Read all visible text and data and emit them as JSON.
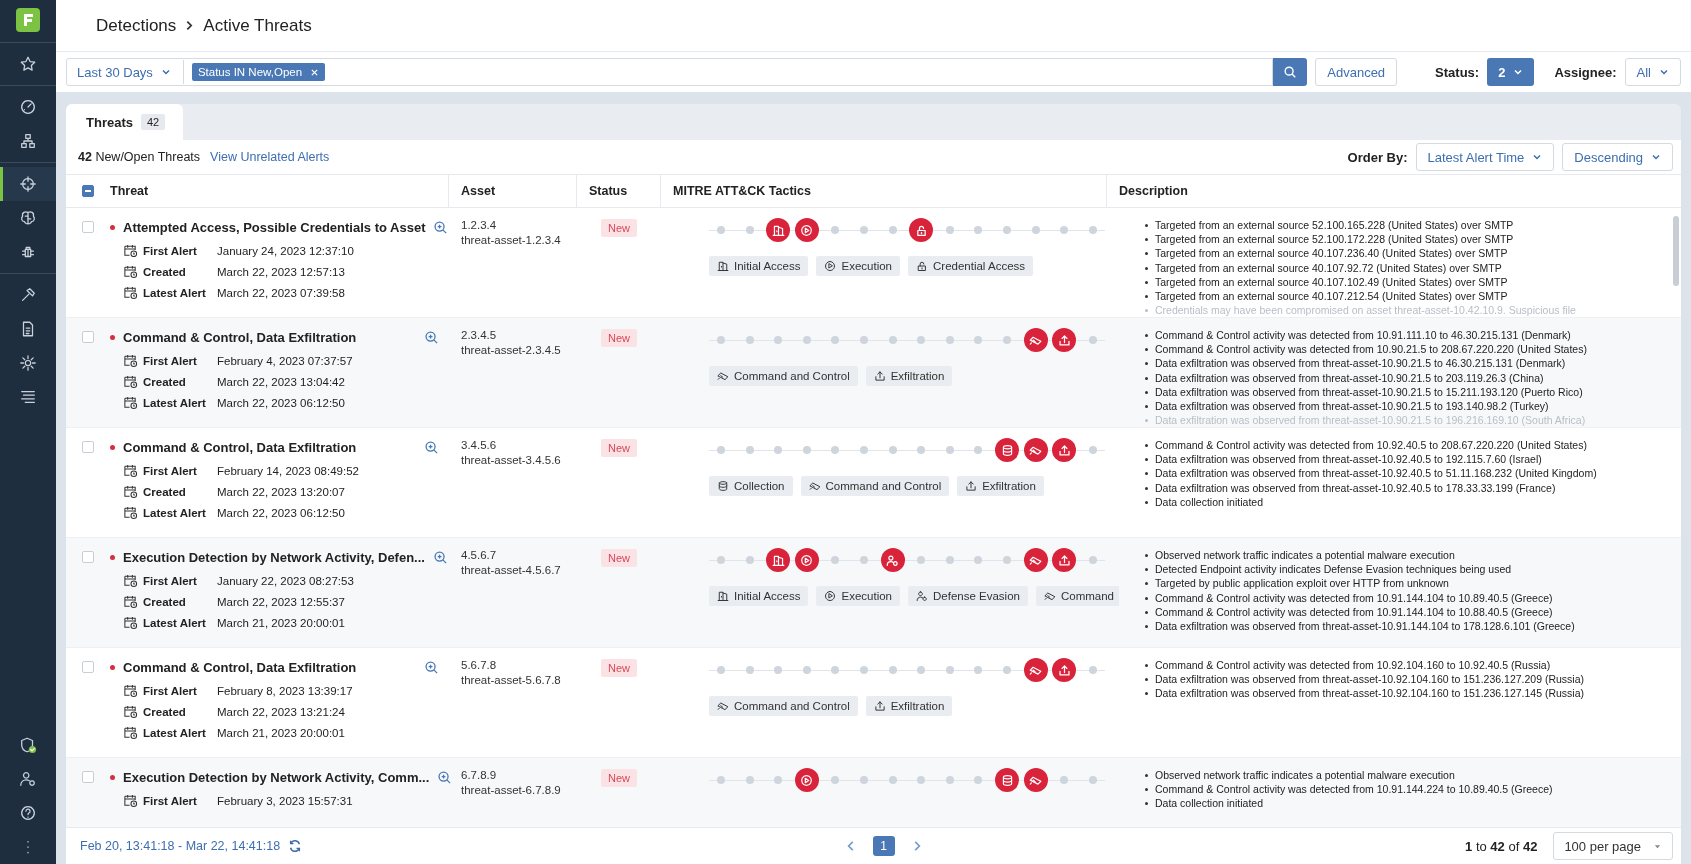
{
  "sidebar": {
    "groups": [
      {
        "items": [
          {
            "kind": "star",
            "selected": false
          }
        ]
      },
      {
        "items": [
          {
            "kind": "gauge",
            "selected": false
          },
          {
            "kind": "network",
            "selected": false
          }
        ]
      },
      {
        "items": [
          {
            "kind": "crosshair",
            "selected": true
          },
          {
            "kind": "brain",
            "selected": false
          },
          {
            "kind": "bug",
            "selected": false
          }
        ]
      },
      {
        "items": [
          {
            "kind": "hammer",
            "selected": false
          },
          {
            "kind": "document",
            "selected": false
          },
          {
            "kind": "gear",
            "selected": false
          },
          {
            "kind": "list",
            "selected": false
          }
        ]
      }
    ],
    "bottom_items": [
      {
        "kind": "shield-check",
        "selected": false
      },
      {
        "kind": "user-gear",
        "selected": false
      },
      {
        "kind": "help",
        "selected": false
      },
      {
        "kind": "more",
        "selected": false
      }
    ]
  },
  "breadcrumb": [
    "Detections",
    "Active Threats"
  ],
  "filter": {
    "date_range": "Last 30 Days",
    "chip": "Status IN New,Open",
    "advanced": "Advanced",
    "status_label": "Status:",
    "status_value": "2",
    "assignee_label": "Assignee:",
    "assignee_value": "All"
  },
  "tabs": [
    {
      "label": "Threats",
      "count": "42",
      "selected": true
    }
  ],
  "summary": "**42** New/Open Threats",
  "unrelated_link": "View Unrelated Alerts",
  "order_by": {
    "label": "Order By:",
    "field": "Latest Alert Time",
    "direction": "Descending"
  },
  "table": {
    "select_all": {
      "indeterminate": true
    },
    "columns": [
      "Threat",
      "Asset",
      "Status",
      "MITRE ATT&CK Tactics",
      "Description"
    ],
    "rows": [
      {
        "checked": false,
        "title": "Attempted Access, Possible Credentials to Asset",
        "dates": [
          {
            "label": "First Alert",
            "value": "January 24, 2023 12:37:10"
          },
          {
            "label": "Created",
            "value": "March 22, 2023 12:57:13"
          },
          {
            "label": "Latest Alert",
            "value": "March 22, 2023 07:39:58"
          }
        ],
        "asset_ip": "1.2.3.4",
        "asset_name": "threat-asset-1.2.3.4",
        "status": "New",
        "timeline": [
          {
            "active": false
          },
          {
            "active": false
          },
          {
            "active": true,
            "kind": "initial-access"
          },
          {
            "active": true,
            "kind": "execution"
          },
          {
            "active": false
          },
          {
            "active": false
          },
          {
            "active": false
          },
          {
            "active": true,
            "kind": "credential-access"
          },
          {
            "active": false
          },
          {
            "active": false
          },
          {
            "active": false
          },
          {
            "active": false
          },
          {
            "active": false
          },
          {
            "active": false
          }
        ],
        "tags": [
          {
            "label": "Initial Access",
            "kind": "initial-access"
          },
          {
            "label": "Execution",
            "kind": "execution"
          },
          {
            "label": "Credential Access",
            "kind": "credential-access"
          }
        ],
        "truncated": true,
        "description": [
          "Targeted from an external source 52.100.165.228 (United States) over SMTP",
          "Targeted from an external source 52.100.172.228 (United States) over SMTP",
          "Targeted from an external source 40.107.236.40 (United States) over SMTP",
          "Targeted from an external source 40.107.92.72 (United States) over SMTP",
          "Targeted from an external source 40.107.102.49 (United States) over SMTP",
          "Targeted from an external source 40.107.212.54 (United States) over SMTP",
          "Credentials may have been compromised on asset threat-asset-10.42.10.9. Suspicious file"
        ]
      },
      {
        "checked": false,
        "title": "Command & Control, Data Exfiltration",
        "dates": [
          {
            "label": "First Alert",
            "value": "February 4, 2023 07:37:57"
          },
          {
            "label": "Created",
            "value": "March 22, 2023 13:04:42"
          },
          {
            "label": "Latest Alert",
            "value": "March 22, 2023 06:12:50"
          }
        ],
        "asset_ip": "2.3.4.5",
        "asset_name": "threat-asset-2.3.4.5",
        "status": "New",
        "timeline": [
          {
            "active": false
          },
          {
            "active": false
          },
          {
            "active": false
          },
          {
            "active": false
          },
          {
            "active": false
          },
          {
            "active": false
          },
          {
            "active": false
          },
          {
            "active": false
          },
          {
            "active": false
          },
          {
            "active": false
          },
          {
            "active": false
          },
          {
            "active": true,
            "kind": "command-and-control"
          },
          {
            "active": true,
            "kind": "exfiltration"
          },
          {
            "active": false
          }
        ],
        "tags": [
          {
            "label": "Command and Control",
            "kind": "command-and-control"
          },
          {
            "label": "Exfiltration",
            "kind": "exfiltration"
          }
        ],
        "truncated": true,
        "description": [
          "Command & Control activity was detected from 10.91.111.10 to 46.30.215.131 (Denmark)",
          "Command & Control activity was detected from 10.90.21.5 to 208.67.220.220 (United States)",
          "Data exfiltration was observed from threat-asset-10.90.21.5 to 46.30.215.131 (Denmark)",
          "Data exfiltration was observed from threat-asset-10.90.21.5 to 203.119.26.3 (China)",
          "Data exfiltration was observed from threat-asset-10.90.21.5 to 15.211.193.120 (Puerto Rico)",
          "Data exfiltration was observed from threat-asset-10.90.21.5 to 193.140.98.2 (Turkey)",
          "Data exfiltration was observed from threat-asset-10.90.21.5 to 196.216.169.10 (South Africa)"
        ]
      },
      {
        "checked": false,
        "title": "Command & Control, Data Exfiltration",
        "dates": [
          {
            "label": "First Alert",
            "value": "February 14, 2023 08:49:52"
          },
          {
            "label": "Created",
            "value": "March 22, 2023 13:20:07"
          },
          {
            "label": "Latest Alert",
            "value": "March 22, 2023 06:12:50"
          }
        ],
        "asset_ip": "3.4.5.6",
        "asset_name": "threat-asset-3.4.5.6",
        "status": "New",
        "timeline": [
          {
            "active": false
          },
          {
            "active": false
          },
          {
            "active": false
          },
          {
            "active": false
          },
          {
            "active": false
          },
          {
            "active": false
          },
          {
            "active": false
          },
          {
            "active": false
          },
          {
            "active": false
          },
          {
            "active": false
          },
          {
            "active": true,
            "kind": "collection"
          },
          {
            "active": true,
            "kind": "command-and-control"
          },
          {
            "active": true,
            "kind": "exfiltration"
          },
          {
            "active": false
          }
        ],
        "tags": [
          {
            "label": "Collection",
            "kind": "collection"
          },
          {
            "label": "Command and Control",
            "kind": "command-and-control"
          },
          {
            "label": "Exfiltration",
            "kind": "exfiltration"
          }
        ],
        "truncated": false,
        "description": [
          "Command & Control activity was detected from 10.92.40.5 to 208.67.220.220 (United States)",
          "Data exfiltration was observed from threat-asset-10.92.40.5 to 192.115.7.60 (Israel)",
          "Data exfiltration was observed from threat-asset-10.92.40.5 to 51.11.168.232 (United Kingdom)",
          "Data exfiltration was observed from threat-asset-10.92.40.5 to 178.33.33.199 (France)",
          "Data collection initiated"
        ]
      },
      {
        "checked": false,
        "title": "Execution Detection by Network Activity, Defen...",
        "dates": [
          {
            "label": "First Alert",
            "value": "January 22, 2023 08:27:53"
          },
          {
            "label": "Created",
            "value": "March 22, 2023 12:55:37"
          },
          {
            "label": "Latest Alert",
            "value": "March 21, 2023 20:00:01"
          }
        ],
        "asset_ip": "4.5.6.7",
        "asset_name": "threat-asset-4.5.6.7",
        "status": "New",
        "timeline": [
          {
            "active": false
          },
          {
            "active": false
          },
          {
            "active": true,
            "kind": "initial-access"
          },
          {
            "active": true,
            "kind": "execution"
          },
          {
            "active": false
          },
          {
            "active": false
          },
          {
            "active": true,
            "kind": "defense-evasion"
          },
          {
            "active": false
          },
          {
            "active": false
          },
          {
            "active": false
          },
          {
            "active": false
          },
          {
            "active": true,
            "kind": "command-and-control"
          },
          {
            "active": true,
            "kind": "exfiltration"
          },
          {
            "active": false
          }
        ],
        "tags": [
          {
            "label": "Initial Access",
            "kind": "initial-access"
          },
          {
            "label": "Execution",
            "kind": "execution"
          },
          {
            "label": "Defense Evasion",
            "kind": "defense-evasion"
          },
          {
            "label": "Command",
            "kind": "command-and-control"
          }
        ],
        "truncated": false,
        "description": [
          "Observed network traffic indicates a potential malware execution",
          "Detected Endpoint activity indicates Defense Evasion techniques being used",
          "Targeted by public application exploit over HTTP from unknown",
          "Command & Control activity was detected from 10.91.144.104 to 10.89.40.5 (Greece)",
          "Command & Control activity was detected from 10.91.144.104 to 10.88.40.5 (Greece)",
          "Data exfiltration was observed from threat-asset-10.91.144.104 to 178.128.6.101 (Greece)"
        ]
      },
      {
        "checked": false,
        "title": "Command & Control, Data Exfiltration",
        "dates": [
          {
            "label": "First Alert",
            "value": "February 8, 2023 13:39:17"
          },
          {
            "label": "Created",
            "value": "March 22, 2023 13:21:24"
          },
          {
            "label": "Latest Alert",
            "value": "March 21, 2023 20:00:01"
          }
        ],
        "asset_ip": "5.6.7.8",
        "asset_name": "threat-asset-5.6.7.8",
        "status": "New",
        "timeline": [
          {
            "active": false
          },
          {
            "active": false
          },
          {
            "active": false
          },
          {
            "active": false
          },
          {
            "active": false
          },
          {
            "active": false
          },
          {
            "active": false
          },
          {
            "active": false
          },
          {
            "active": false
          },
          {
            "active": false
          },
          {
            "active": false
          },
          {
            "active": true,
            "kind": "command-and-control"
          },
          {
            "active": true,
            "kind": "exfiltration"
          },
          {
            "active": false
          }
        ],
        "tags": [
          {
            "label": "Command and Control",
            "kind": "command-and-control"
          },
          {
            "label": "Exfiltration",
            "kind": "exfiltration"
          }
        ],
        "truncated": false,
        "description": [
          "Command & Control activity was detected from 10.92.104.160 to 10.92.40.5 (Russia)",
          "Data exfiltration was observed from threat-asset-10.92.104.160 to 151.236.127.209 (Russia)",
          "Data exfiltration was observed from threat-asset-10.92.104.160 to 151.236.127.145 (Russia)"
        ]
      },
      {
        "checked": false,
        "title": "Execution Detection by Network Activity, Comm...",
        "dates": [
          {
            "label": "First Alert",
            "value": "February 3, 2023 15:57:31"
          }
        ],
        "asset_ip": "6.7.8.9",
        "asset_name": "threat-asset-6.7.8.9",
        "status": "New",
        "timeline": [
          {
            "active": false
          },
          {
            "active": false
          },
          {
            "active": false
          },
          {
            "active": true,
            "kind": "execution"
          },
          {
            "active": false
          },
          {
            "active": false
          },
          {
            "active": false
          },
          {
            "active": false
          },
          {
            "active": false
          },
          {
            "active": false
          },
          {
            "active": true,
            "kind": "collection"
          },
          {
            "active": true,
            "kind": "command-and-control"
          },
          {
            "active": false
          },
          {
            "active": false
          }
        ],
        "truncated": false,
        "description": [
          "Observed network traffic indicates a potential malware execution",
          "Command & Control activity was detected from 10.91.144.224 to 10.89.40.5 (Greece)",
          "Data collection initiated"
        ]
      }
    ]
  },
  "footer": {
    "time_range": "Feb 20, 13:41:18 - Mar 22, 14:41:18",
    "pages": [
      {
        "label": "1",
        "selected": true
      }
    ],
    "range": "**1** to **42** of **42**",
    "page_size": "100 per page"
  }
}
